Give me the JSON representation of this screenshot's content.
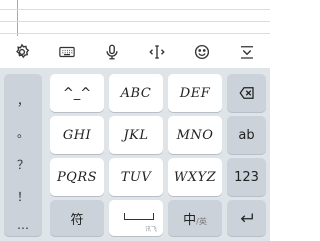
{
  "toolbar": {
    "icons": [
      "settings-icon",
      "keyboard-icon",
      "microphone-icon",
      "cursor-move-icon",
      "emoji-icon",
      "collapse-keyboard-icon"
    ]
  },
  "keyboard": {
    "punctuation": [
      "，",
      "。",
      "？",
      "！",
      "…"
    ],
    "rows": [
      {
        "keys": [
          "^_^",
          "ABC",
          "DEF"
        ]
      },
      {
        "keys": [
          "GHI",
          "JKL",
          "MNO"
        ]
      },
      {
        "keys": [
          "PQRS",
          "TUV",
          "WXYZ"
        ]
      }
    ],
    "side_keys": [
      "ab",
      "123"
    ],
    "bottom": {
      "symbols": "符",
      "space_brand": "讯飞",
      "lang_main": "中",
      "lang_alt": "/英"
    }
  },
  "colors": {
    "keyboard_bg": "#dfe4e9",
    "key_bg": "#ffffff",
    "function_key_bg": "#cbd2d9",
    "paper_line": "#f3d2d2",
    "paper_margin": "#e88c8c"
  }
}
